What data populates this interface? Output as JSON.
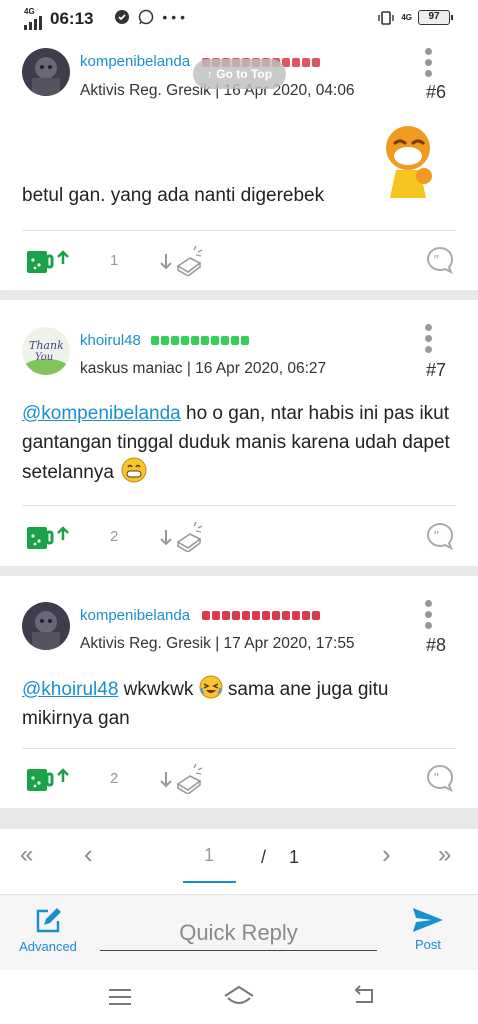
{
  "status_bar": {
    "network": "4G",
    "time": "06:13",
    "network_right": "4G",
    "battery": "97"
  },
  "goto_top": {
    "label": "↑ Go to Top"
  },
  "posts": [
    {
      "username": "kompenibelanda",
      "rep_color": "#e05563",
      "meta": "Aktivis Reg. Gresik | 16 Apr 2020, 04:06",
      "number": "#6",
      "content": "betul gan. yang ada nanti digerebek",
      "cendol_count": "1"
    },
    {
      "username": "khoirul48",
      "rep_color": "#35d05a",
      "meta": "kaskus maniac | 16 Apr 2020, 06:27",
      "number": "#7",
      "mention": "@kompenibelanda",
      "content": " ho o gan, ntar habis ini pas ikut gantangan tinggal duduk manis karena udah dapet setelannya",
      "cendol_count": "2"
    },
    {
      "username": "kompenibelanda",
      "rep_color": "#d93a4c",
      "meta": "Aktivis Reg. Gresik | 17 Apr 2020, 17:55",
      "number": "#8",
      "mention": "@khoirul48",
      "content_a": " wkwkwk ",
      "content_b": " sama ane juga gitu mikirnya gan",
      "cendol_count": "2"
    }
  ],
  "pagination": {
    "first": "«",
    "prev": "‹",
    "current": "1",
    "slash": "/",
    "total": "1",
    "next": "›",
    "last": "»"
  },
  "reply_bar": {
    "advanced_label": "Advanced",
    "quick_reply_placeholder": "Quick Reply",
    "post_label": "Post"
  },
  "accent": "#1a8fd0",
  "cendol_color": "#1aa24a"
}
